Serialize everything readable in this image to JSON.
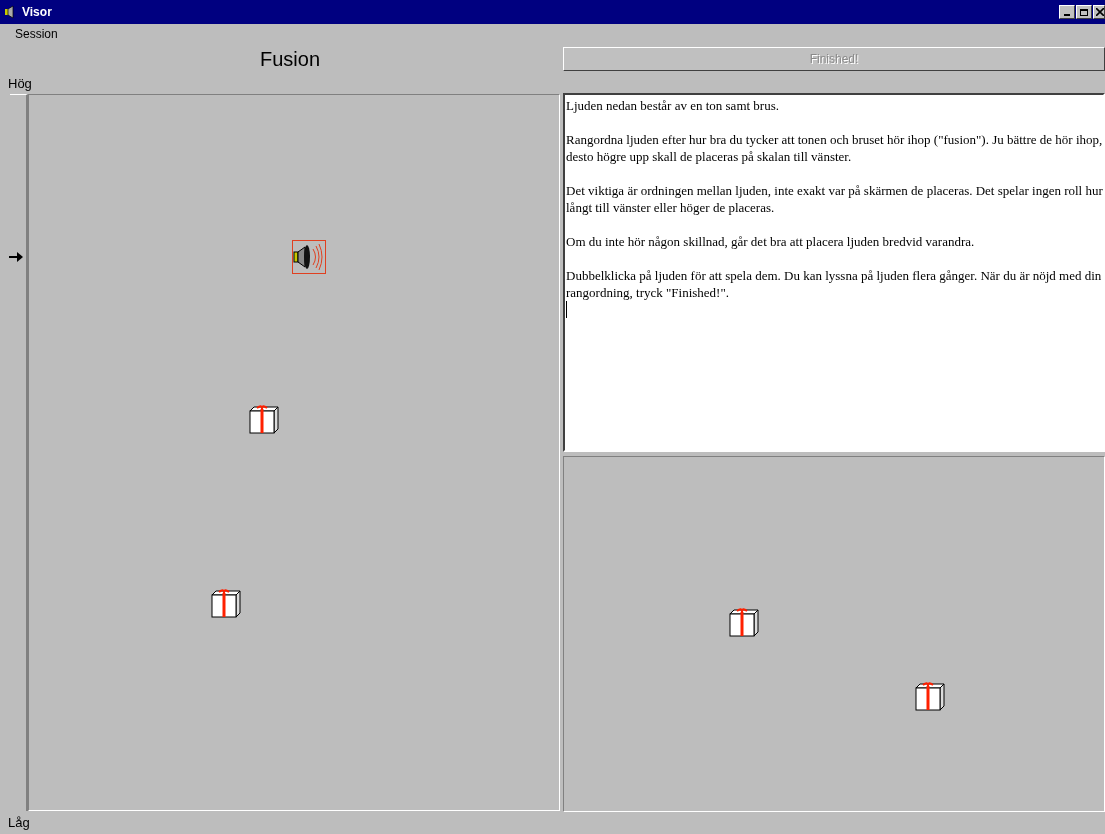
{
  "window": {
    "title": "Visor"
  },
  "menu": [
    {
      "label": "Session"
    }
  ],
  "ranking_panel": {
    "title": "Fusion",
    "scale_top": "Hög",
    "scale_bottom": "Låg",
    "sounds": [
      {
        "kind": "speaker",
        "selected": true
      },
      {
        "kind": "gift",
        "selected": false
      },
      {
        "kind": "gift",
        "selected": false
      }
    ]
  },
  "finish_button": {
    "label": "Finished!",
    "disabled": true
  },
  "instructions": {
    "paragraphs": [
      "Ljuden nedan består av en ton samt brus.",
      "Rangordna ljuden efter hur bra du tycker att tonen och bruset hör ihop (\"fusion\"). Ju bättre de hör ihop, desto högre upp skall de placeras på skalan till vänster.",
      "Det viktiga är ordningen mellan ljuden, inte exakt var på skärmen de placeras. Det spelar ingen roll hur långt till vänster eller höger de placeras.",
      "Om du inte hör någon skillnad, går det bra att placera ljuden bredvid varandra.",
      "Dubbelklicka på ljuden för att spela dem. Du kan lyssna på ljuden flera gånger. När du är nöjd med din rangordning, tryck \"Finished!\"."
    ]
  },
  "unranked_panel": {
    "sounds": [
      {
        "kind": "gift",
        "selected": false
      },
      {
        "kind": "gift",
        "selected": false
      }
    ]
  }
}
